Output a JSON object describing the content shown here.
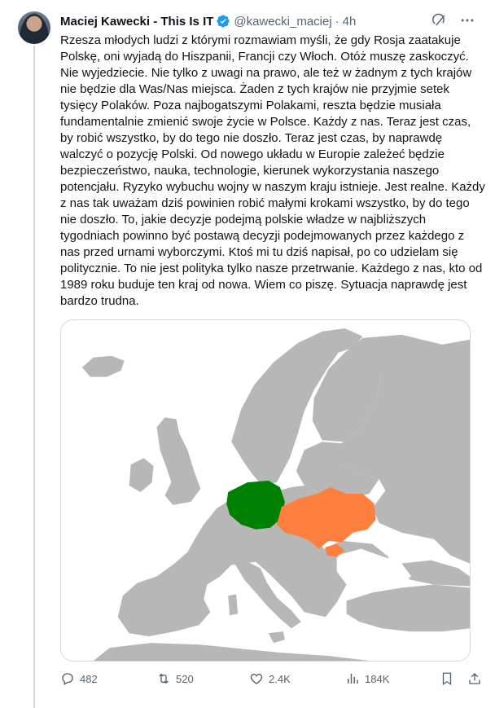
{
  "author": {
    "display_name": "Maciej Kawecki - This Is IT",
    "handle": "@kawecki_maciej",
    "separator": "·",
    "time": "4h"
  },
  "tweet": {
    "text": "Rzesza młodych ludzi z którymi rozmawiam myśli, że gdy Rosja zaatakuje Polskę, oni wyjadą do Hiszpanii, Francji czy Włoch. Otóż muszę zaskoczyć. Nie wyjedziecie. Nie tylko z uwagi na prawo, ale też w żadnym z tych krajów nie będzie dla Was/Nas miejsca. Żaden z tych krajów nie przyjmie setek tysięcy Polaków. Poza najbogatszymi Polakami, reszta będzie musiała fundamentalnie zmienić swoje życie w Polsce. Każdy z nas. Teraz jest czas, by robić wszystko, by do tego nie doszło. Teraz jest czas, by naprawdę walczyć o pozycję Polski. Od nowego układu w Europie zależeć będzie bezpieczeństwo, nauka, technologie, kierunek wykorzystania naszego potencjału. Ryzyko wybuchu wojny w naszym kraju istnieje. Jest realne. Każdy z nas tak uważam dziś powinien robić małymi krokami wszystko, by do tego nie doszło. To, jakie decyzje podejmą polskie władze w najbliższych tygodniach powinno być postawą decyzji podejmowanych przez każdego z nas przed urnami wyborczymi. Ktoś mi tu dziś napisał, po co udzielam się politycznie. To nie jest polityka tylko nasze przetrwanie. Każdego z nas, kto od 1989 roku buduje ten kraj od nowa. Wiem co piszę. Sytuacja naprawdę jest bardzo trudna."
  },
  "media": {
    "map": {
      "sea_color": "#ffffff",
      "land_color": "#b7b7b7",
      "highlighted": [
        {
          "country": "Poland",
          "color": "#008000"
        },
        {
          "country": "Ukraine",
          "color": "#ff7f3f"
        }
      ]
    }
  },
  "actions": {
    "replies": "482",
    "retweets": "520",
    "likes": "2.4K",
    "views": "184K"
  },
  "colors": {
    "verified_blue": "#1d9bf0",
    "muted_text": "#536471",
    "border": "#cfd9de"
  },
  "icons": {
    "grok": "grok-icon",
    "more": "more-icon",
    "verified": "verified-badge-icon",
    "reply": "reply-icon",
    "retweet": "retweet-icon",
    "like": "like-icon",
    "views": "views-icon",
    "bookmark": "bookmark-icon",
    "share": "share-icon"
  }
}
